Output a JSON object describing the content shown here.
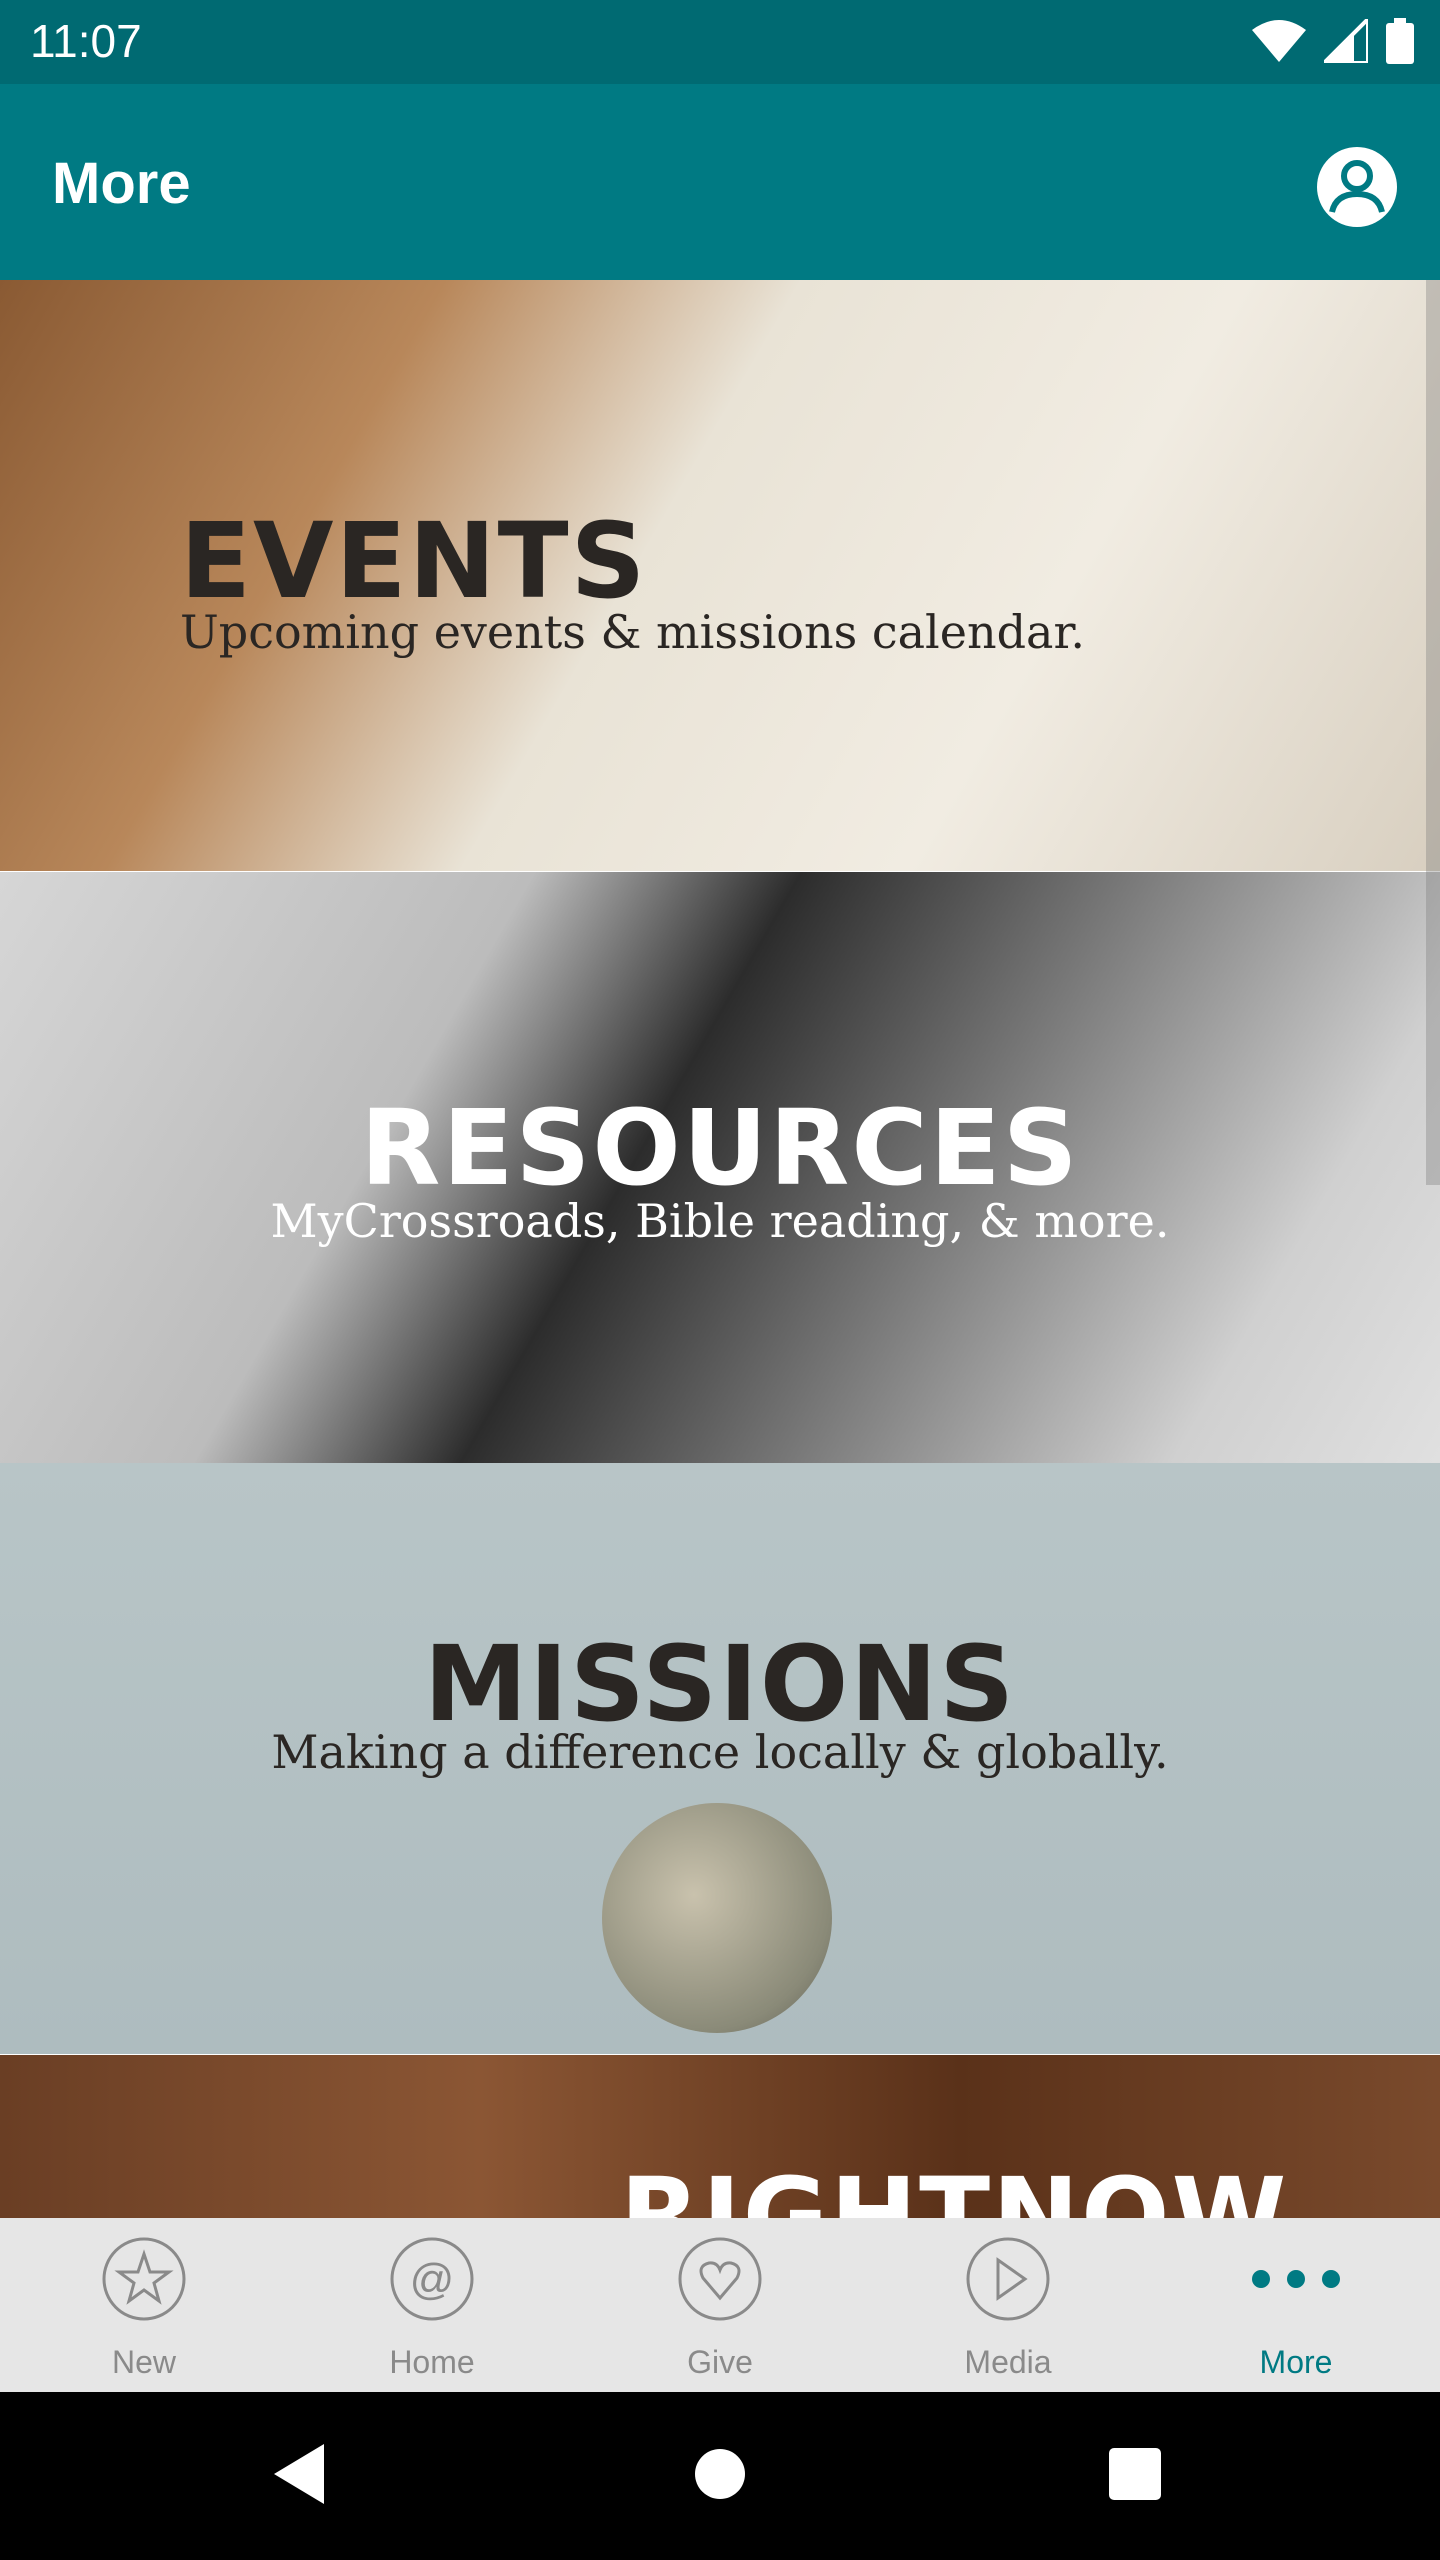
{
  "status_bar": {
    "time": "11:07",
    "icons": [
      "wifi-icon",
      "cellular-icon",
      "battery-icon"
    ]
  },
  "app_bar": {
    "title": "More",
    "profile_icon": "account-circle-icon"
  },
  "banners": [
    {
      "title": "EVENTS",
      "subtitle": "Upcoming events & missions calendar."
    },
    {
      "title": "RESOURCES",
      "subtitle": "MyCrossroads, Bible reading, & more."
    },
    {
      "title": "MISSIONS",
      "subtitle": "Making a difference locally & globally."
    },
    {
      "title": "RIGHTNOW"
    }
  ],
  "bottom_nav": {
    "active_color": "#007a83",
    "items": [
      {
        "label": "New",
        "icon": "star-icon"
      },
      {
        "label": "Home",
        "icon": "at-icon"
      },
      {
        "label": "Give",
        "icon": "heart-icon"
      },
      {
        "label": "Media",
        "icon": "play-icon"
      },
      {
        "label": "More",
        "icon": "more-dots-icon",
        "active": true
      }
    ]
  },
  "colors": {
    "status_bar": "#006a72",
    "app_bar": "#007a83"
  }
}
